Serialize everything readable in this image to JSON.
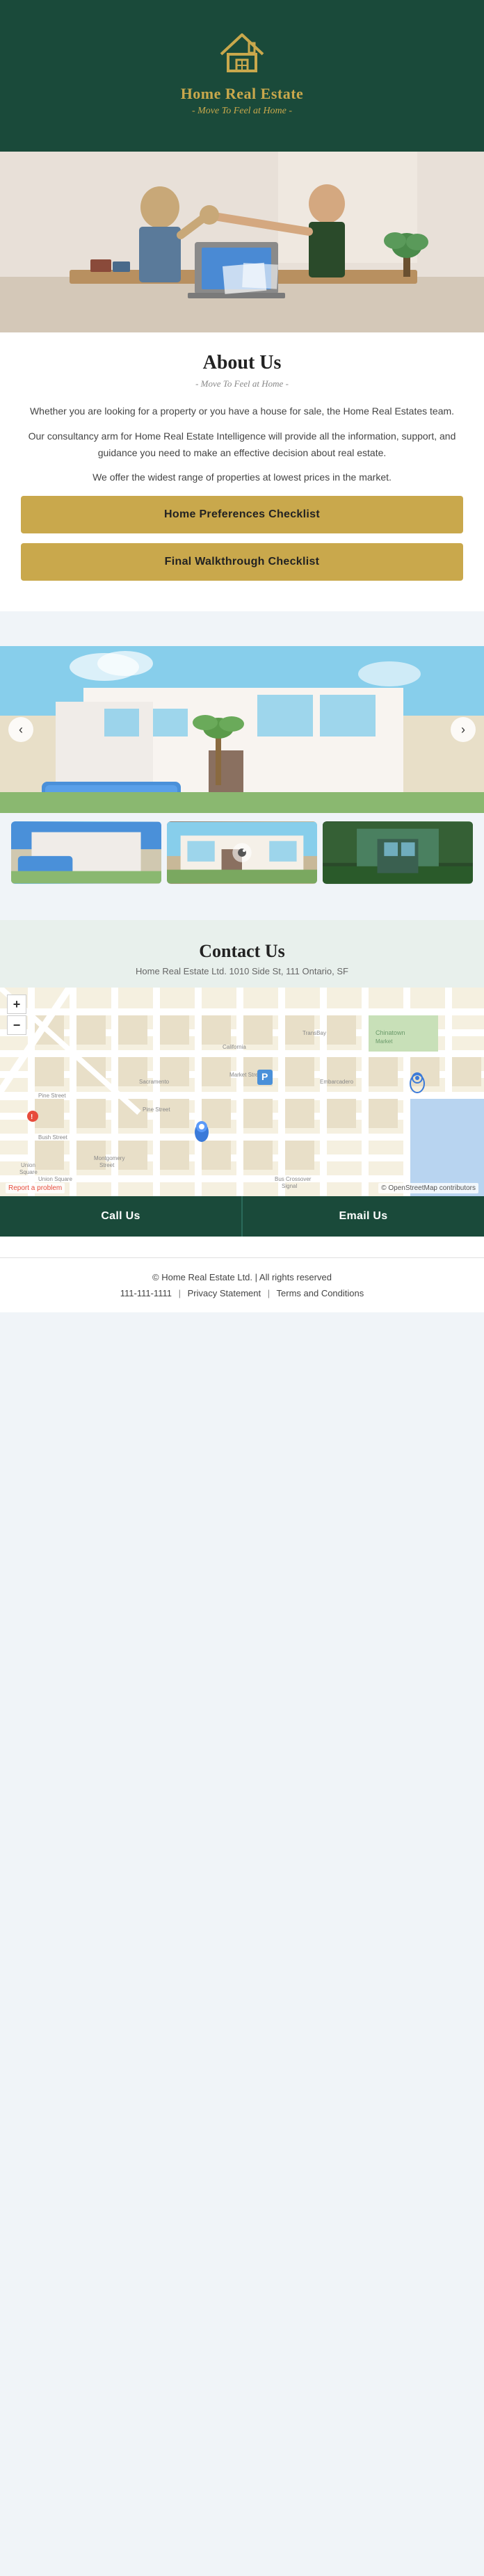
{
  "header": {
    "brand_name": "Home Real Estate",
    "tagline": "- Move To Feel at Home -",
    "logo_alt": "house-logo"
  },
  "about": {
    "title": "About Us",
    "subtitle": "- Move To Feel at Home -",
    "paragraphs": [
      "Whether you are looking for a property or you have a house for sale, the Home Real Estates team.",
      "Our consultancy arm for Home Real Estate Intelligence will provide all the information, support, and guidance you need to make an effective decision about real estate.",
      "We offer the widest range of properties at lowest prices in the market."
    ],
    "btn_checklist1": "Home Preferences Checklist",
    "btn_checklist2": "Final Walkthrough Checklist"
  },
  "gallery": {
    "arrow_left": "‹",
    "arrow_right": "›",
    "eye_icon": "👁",
    "thumbnails": [
      {
        "id": "thumb-1",
        "alt": "property-exterior-1"
      },
      {
        "id": "thumb-2",
        "alt": "property-exterior-2"
      },
      {
        "id": "thumb-3",
        "alt": "property-exterior-3"
      }
    ]
  },
  "contact": {
    "title": "Contact Us",
    "address": "Home Real Estate Ltd. 1010 Side St,  111 Ontario, SF",
    "map_plus": "+",
    "map_minus": "−",
    "map_report": "Report a problem",
    "map_attribution": "© OpenStreetMap contributors",
    "parking_label": "P",
    "btn_call": "Call Us",
    "btn_email": "Email Us"
  },
  "footer": {
    "copyright": "© Home Real Estate Ltd.  |  All rights reserved",
    "phone": "111-111-1111",
    "sep1": "|",
    "privacy": "Privacy Statement",
    "sep2": "|",
    "terms": "Terms and Conditions"
  }
}
